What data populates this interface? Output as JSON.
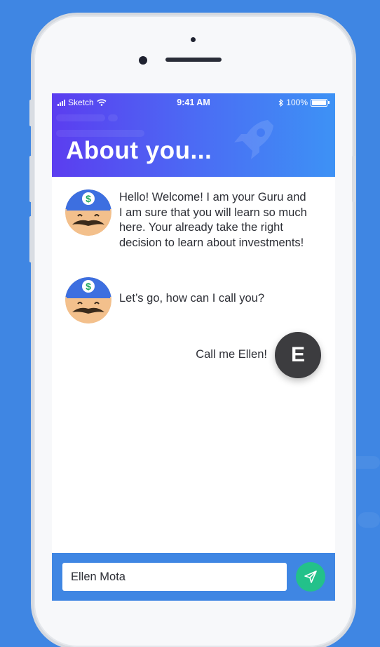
{
  "status_bar": {
    "carrier": "Sketch",
    "time": "9:41 AM",
    "battery": "100%"
  },
  "header": {
    "title": "About you..."
  },
  "chat": {
    "messages": [
      {
        "sender": "guru",
        "lines": [
          "Hello! Welcome! I am your Guru and",
          "I am sure that you will learn so much",
          "here. Your already take the right",
          "decision to learn about investments!"
        ]
      },
      {
        "sender": "guru",
        "lines": [
          "Let’s go, how can I call you?"
        ]
      },
      {
        "sender": "user",
        "text": "Call me Ellen!",
        "avatar_initial": "E"
      }
    ]
  },
  "composer": {
    "value": "Ellen Mota"
  },
  "colors": {
    "background": "#3f86e3",
    "header_start": "#5b3df0",
    "header_end": "#3d92f5",
    "send_button": "#23c18a",
    "user_avatar": "#3c3c3f"
  },
  "icons": [
    "signal-icon",
    "wifi-icon",
    "bluetooth-icon",
    "battery-icon",
    "guru-avatar-icon",
    "send-icon"
  ]
}
